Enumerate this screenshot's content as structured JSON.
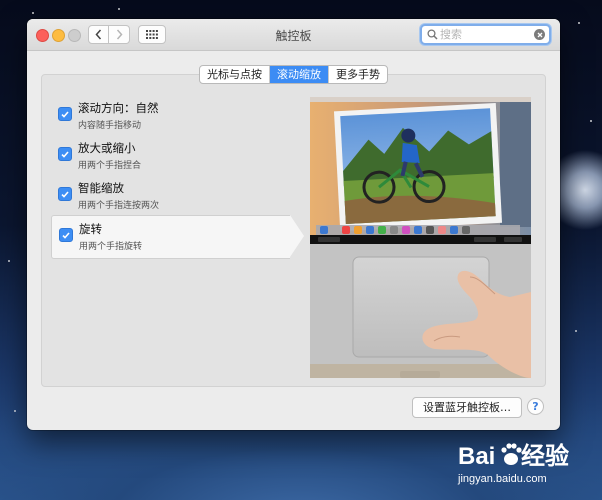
{
  "window": {
    "title": "触控板"
  },
  "search": {
    "placeholder": "搜索"
  },
  "tabs": [
    {
      "label": "光标与点按",
      "active": false
    },
    {
      "label": "滚动缩放",
      "active": true
    },
    {
      "label": "更多手势",
      "active": false
    }
  ],
  "options": [
    {
      "title": "滚动方向：自然",
      "subtitle": "内容随手指移动",
      "checked": true,
      "selected": false
    },
    {
      "title": "放大或缩小",
      "subtitle": "用两个手指捏合",
      "checked": true,
      "selected": false
    },
    {
      "title": "智能缩放",
      "subtitle": "用两个手指连按两次",
      "checked": true,
      "selected": false
    },
    {
      "title": "旋转",
      "subtitle": "用两个手指旋转",
      "checked": true,
      "selected": true
    }
  ],
  "bluetooth_button": "设置蓝牙触控板…",
  "help_button": "?",
  "watermark": {
    "logo": "Bai du 经验",
    "url": "jingyan.baidu.com"
  },
  "colors": {
    "accent": "#3c8cf4",
    "close": "#fc605b",
    "minimize": "#fdbc40"
  }
}
